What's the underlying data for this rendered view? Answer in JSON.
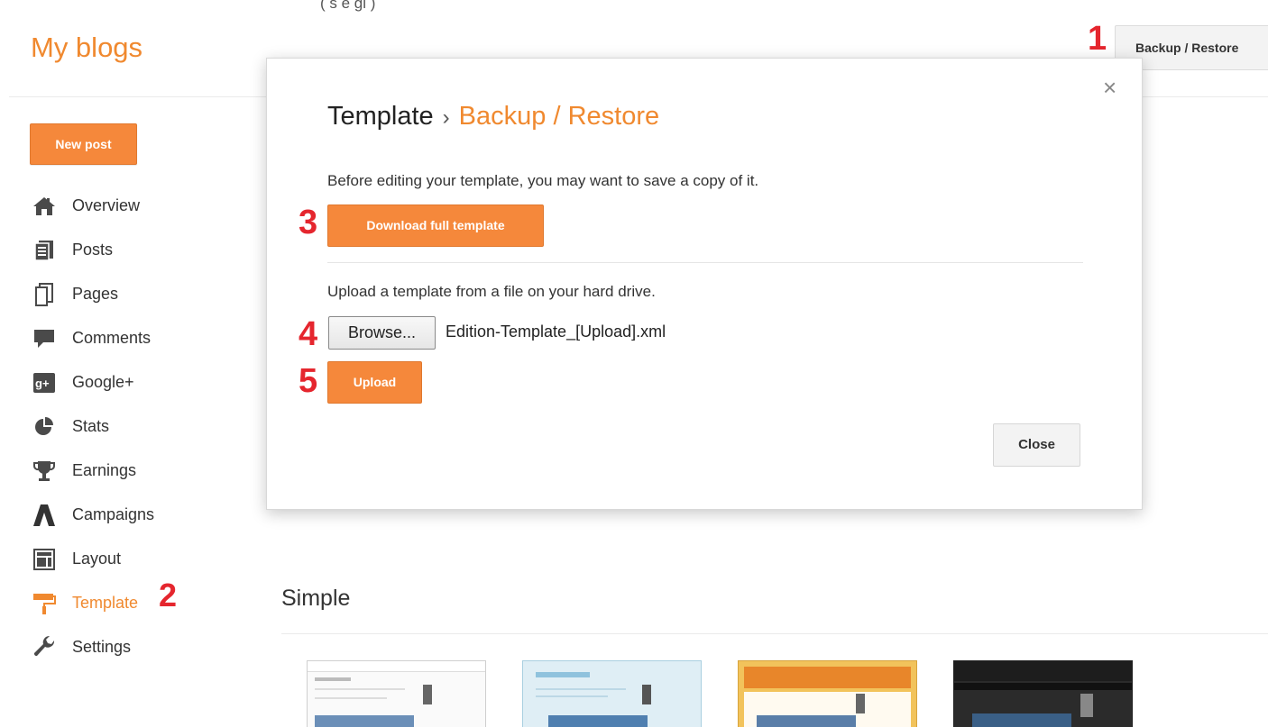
{
  "top_fragment": "(                    s  e  gi  )",
  "brand": "My blogs",
  "header": {
    "backup_restore_label": "Backup / Restore"
  },
  "sidebar": {
    "new_post_label": "New post",
    "items": [
      {
        "label": "Overview",
        "icon": "home-icon"
      },
      {
        "label": "Posts",
        "icon": "posts-icon"
      },
      {
        "label": "Pages",
        "icon": "page-icon"
      },
      {
        "label": "Comments",
        "icon": "comment-icon"
      },
      {
        "label": "Google+",
        "icon": "google-plus-icon"
      },
      {
        "label": "Stats",
        "icon": "pie-chart-icon"
      },
      {
        "label": "Earnings",
        "icon": "trophy-icon"
      },
      {
        "label": "Campaigns",
        "icon": "adwords-icon"
      },
      {
        "label": "Layout",
        "icon": "layout-icon"
      },
      {
        "label": "Template",
        "icon": "paint-roller-icon",
        "active": true
      },
      {
        "label": "Settings",
        "icon": "wrench-icon"
      }
    ]
  },
  "steps": [
    "1",
    "2",
    "3",
    "4",
    "5"
  ],
  "modal": {
    "breadcrumb_parent": "Template",
    "breadcrumb_separator": "›",
    "breadcrumb_current": "Backup / Restore",
    "download_description": "Before editing your template, you may want to save a copy of it.",
    "download_label": "Download full template",
    "upload_description": "Upload a template from a file on your hard drive.",
    "browse_label": "Browse...",
    "selected_file": "Edition-Template_[Upload].xml",
    "upload_label": "Upload",
    "close_label": "Close",
    "close_glyph": "×"
  },
  "themes": {
    "section_title": "Simple"
  },
  "colors": {
    "accent": "#f0892f",
    "button_orange": "#f5883b",
    "step_red": "#e5262e"
  }
}
